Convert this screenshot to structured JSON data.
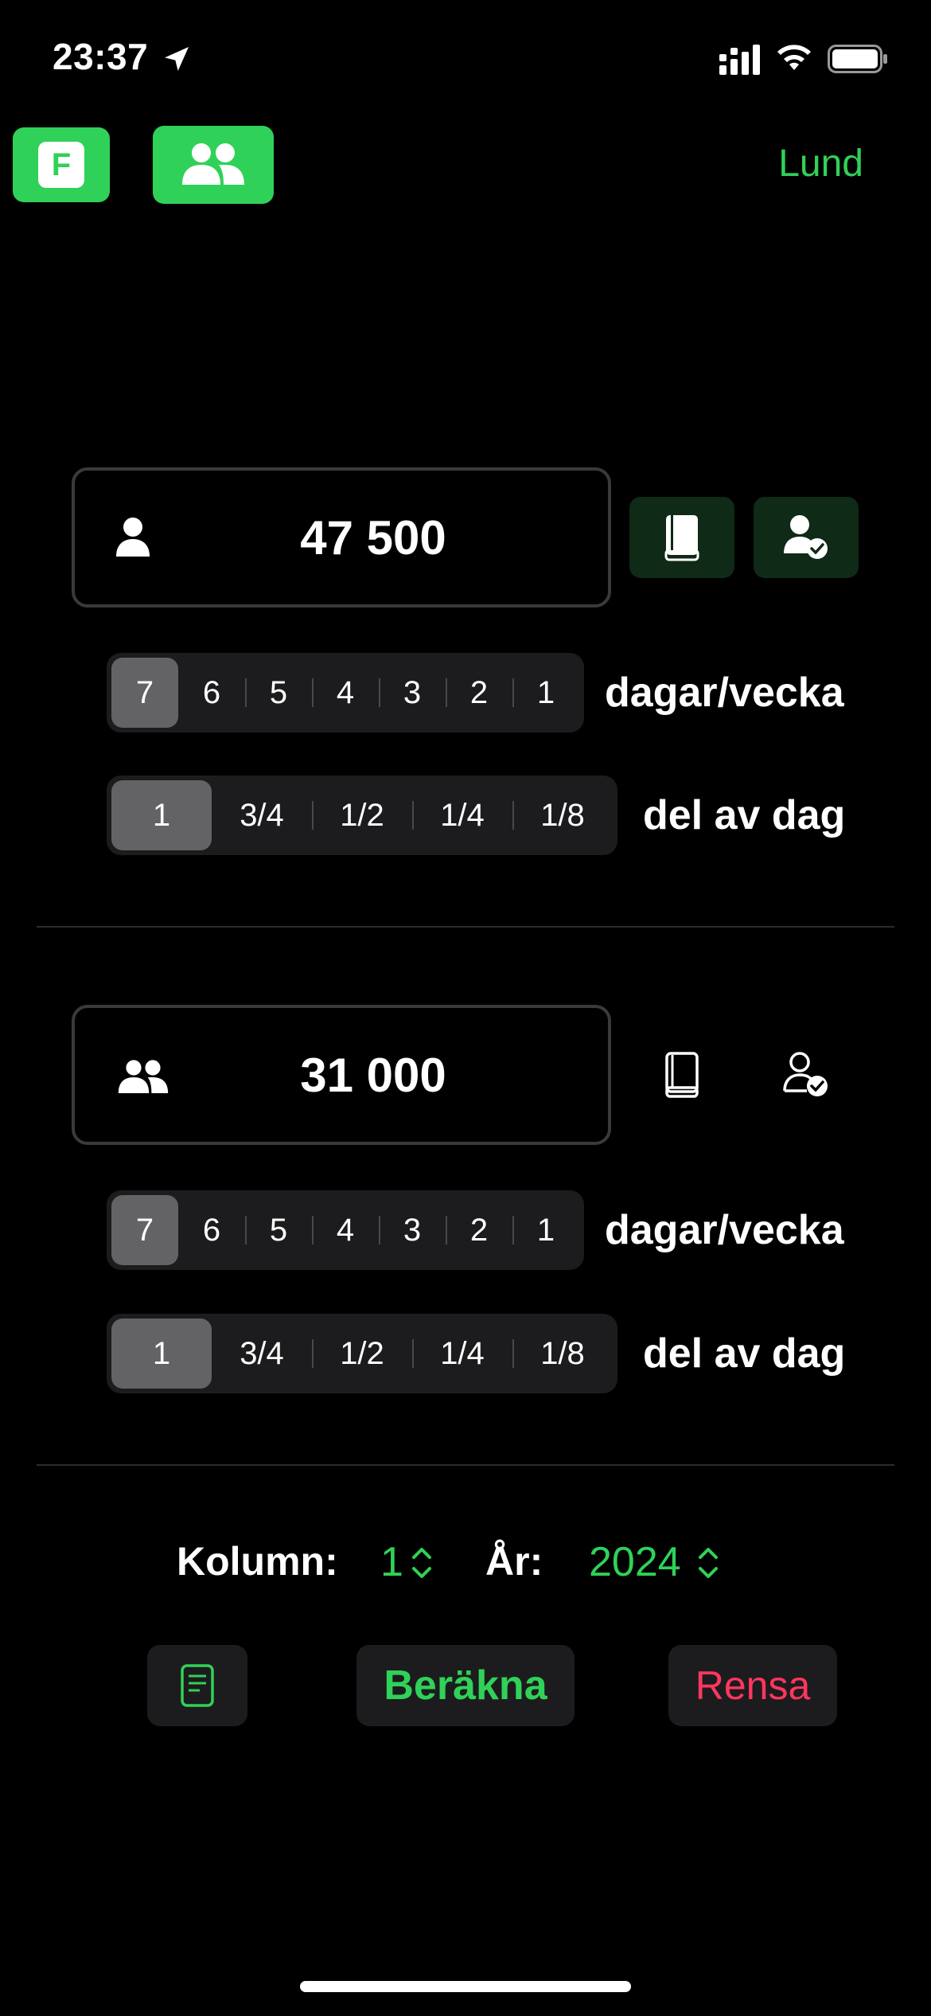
{
  "status_bar": {
    "time": "23:37",
    "icons": [
      "location-arrow-icon",
      "cellular-signal-icon",
      "wifi-icon",
      "battery-icon"
    ]
  },
  "top_bar": {
    "f_button_label": "F",
    "group_button_icon": "two-people-icon",
    "city": "Lund"
  },
  "person1": {
    "icon": "person-icon",
    "amount": "47 500",
    "days": {
      "options": [
        "7",
        "6",
        "5",
        "4",
        "3",
        "2",
        "1"
      ],
      "selected": "7",
      "label": "dagar/vecka"
    },
    "fraction": {
      "options": [
        "1",
        "3/4",
        "1/2",
        "1/4",
        "1/8"
      ],
      "selected": "1",
      "label": "del av dag"
    }
  },
  "person2": {
    "icon": "two-people-icon",
    "amount": "31 000",
    "days": {
      "options": [
        "7",
        "6",
        "5",
        "4",
        "3",
        "2",
        "1"
      ],
      "selected": "7",
      "label": "dagar/vecka"
    },
    "fraction": {
      "options": [
        "1",
        "3/4",
        "1/2",
        "1/4",
        "1/8"
      ],
      "selected": "1",
      "label": "del av dag"
    }
  },
  "picker": {
    "kolumn_label": "Kolumn:",
    "kolumn_value": "1",
    "year_label": "År:",
    "year_value": "2024"
  },
  "actions": {
    "doc_icon": "document-icon",
    "calculate": "Beräkna",
    "clear": "Rensa"
  },
  "colors": {
    "accent_green": "#30d158",
    "clear_red": "#ff375f",
    "background": "#000000"
  }
}
